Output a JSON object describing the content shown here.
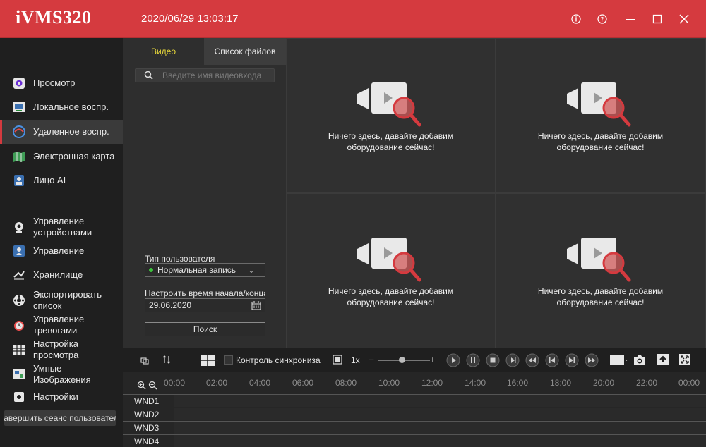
{
  "app": {
    "title": "iVMS320",
    "datetime": "2020/06/29 13:03:17"
  },
  "nav": {
    "items": [
      {
        "label": "Просмотр",
        "icon": "preview-icon"
      },
      {
        "label": "Локальное воспр.",
        "icon": "local-playback-icon"
      },
      {
        "label": "Удаленное воспр.",
        "icon": "remote-playback-icon",
        "active": true
      },
      {
        "label": "Электронная карта",
        "icon": "emap-icon"
      },
      {
        "label": "Лицо AI",
        "icon": "face-ai-icon"
      },
      {
        "label": "Управление устройствами",
        "icon": "device-management-icon"
      },
      {
        "label": "Управление",
        "icon": "management-icon"
      },
      {
        "label": "Хранилище",
        "icon": "storage-icon"
      },
      {
        "label": "Экспортировать список",
        "icon": "export-list-icon"
      },
      {
        "label": "Управление тревогами",
        "icon": "alarm-icon"
      },
      {
        "label": "Настройка просмотра",
        "icon": "view-settings-icon"
      },
      {
        "label": "Умные Изображения",
        "icon": "smart-images-icon"
      },
      {
        "label": "Настройки",
        "icon": "settings-icon"
      }
    ],
    "logout_label": "Завершить сеанс пользователя"
  },
  "panel": {
    "tab_video": "Видео",
    "tab_files": "Список файлов",
    "search_placeholder": "Введите имя видеовхода",
    "user_type_label": "Тип пользователя",
    "user_type_value": "Нормальная запись",
    "time_label": "Настроить время начала/конца",
    "date_value": "29.06.2020",
    "search_button": "Поиск"
  },
  "grid": {
    "empty_line1": "Ничего здесь, давайте добавим",
    "empty_line2": "оборудование сейчас!"
  },
  "toolbar": {
    "sync_label": "Контроль синхрониза",
    "speed": "1x"
  },
  "timeline": {
    "ticks": [
      "00:00",
      "02:00",
      "04:00",
      "06:00",
      "08:00",
      "10:00",
      "12:00",
      "14:00",
      "16:00",
      "18:00",
      "20:00",
      "22:00",
      "00:00"
    ],
    "rows": [
      "WND1",
      "WND2",
      "WND3",
      "WND4"
    ]
  },
  "colors": {
    "accent": "#d53a3f",
    "active_tab": "#e8d83a",
    "status_dot": "#3cc13c"
  }
}
